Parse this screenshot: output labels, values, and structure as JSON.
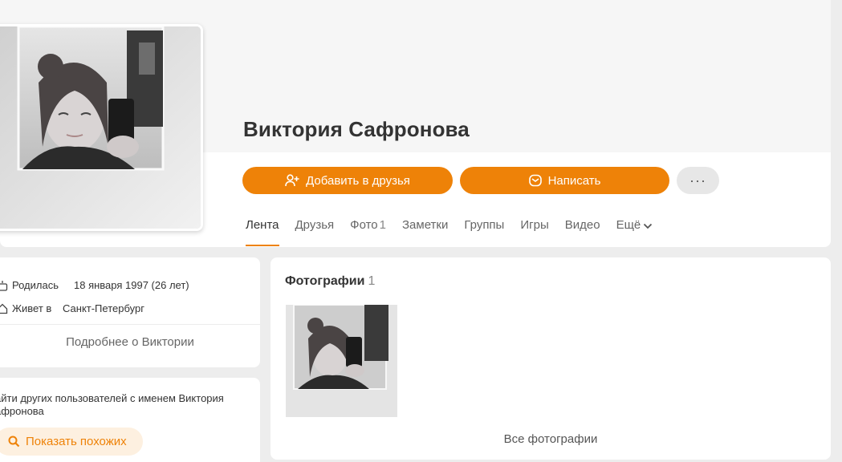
{
  "profile": {
    "name": "Виктория Сафронова"
  },
  "actions": {
    "add_friend": "Добавить в друзья",
    "write": "Написать",
    "more": "···"
  },
  "tabs": [
    {
      "label": "Лента",
      "count": ""
    },
    {
      "label": "Друзья",
      "count": ""
    },
    {
      "label": "Фото",
      "count": "1"
    },
    {
      "label": "Заметки",
      "count": ""
    },
    {
      "label": "Группы",
      "count": ""
    },
    {
      "label": "Игры",
      "count": ""
    },
    {
      "label": "Видео",
      "count": ""
    },
    {
      "label": "Ещё",
      "count": ""
    }
  ],
  "info": {
    "born_label": "Родилась",
    "born_value": "18 января 1997 (26 лет)",
    "lives_label": "Живет в",
    "lives_value": "Санкт-Петербург",
    "more_link": "Подробнее о Виктории"
  },
  "similar": {
    "text": "айти других пользователей с именем Виктория афронова",
    "button": "Показать похожих"
  },
  "photos": {
    "title": "Фотографии",
    "count": "1",
    "all_link": "Все фотографии"
  },
  "colors": {
    "accent": "#ee8208",
    "accent_light": "#fdf0e0"
  }
}
